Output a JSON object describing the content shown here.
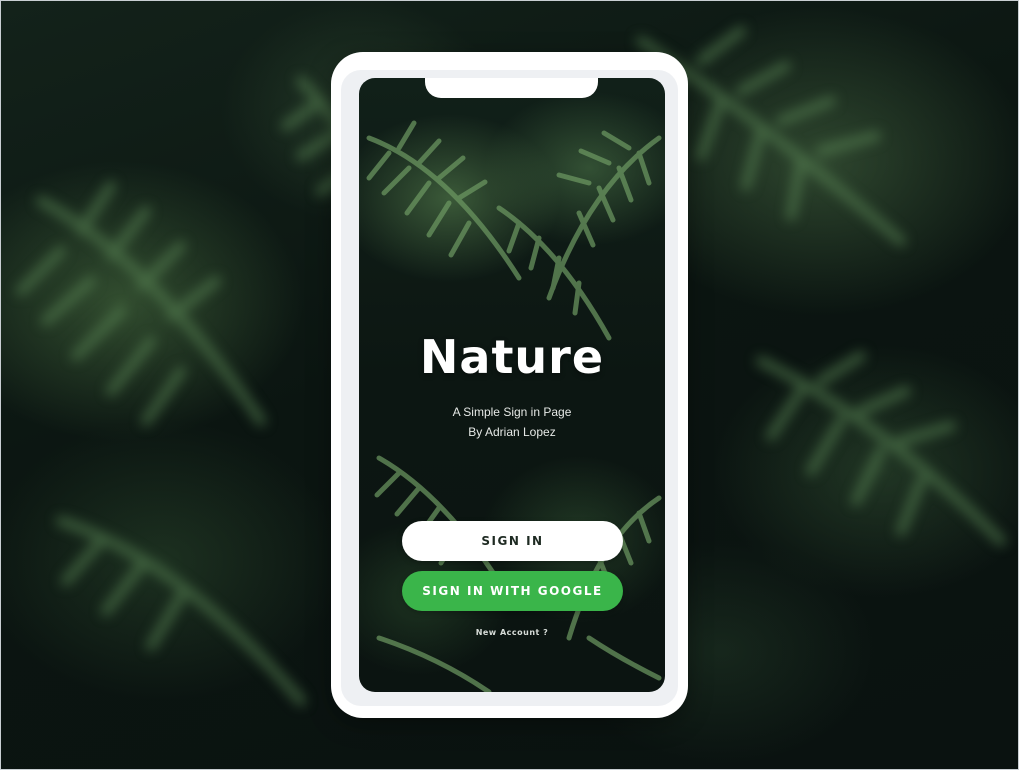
{
  "app": {
    "title": "Nature",
    "subtitle_line1": "A Simple Sign in Page",
    "subtitle_line2": "By Adrian Lopez"
  },
  "actions": {
    "sign_in_label": "SIGN IN",
    "google_sign_in_label": "SIGN IN WITH GOOGLE",
    "new_account_label": "New Account ?"
  },
  "colors": {
    "google_button": "#3ab54a",
    "sign_in_button": "#ffffff",
    "background": "#0a1410"
  }
}
